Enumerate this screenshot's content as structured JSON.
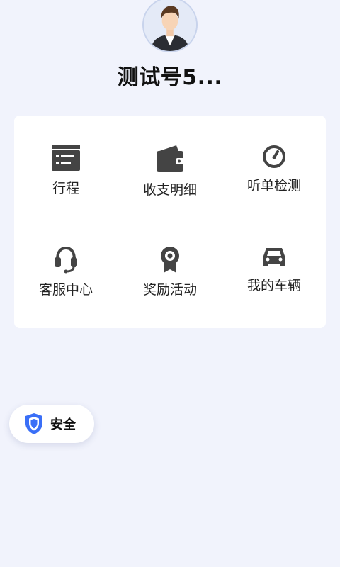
{
  "profile": {
    "name": "测试号5..."
  },
  "menu": {
    "items": [
      {
        "label": "行程",
        "icon": "itinerary-icon"
      },
      {
        "label": "收支明细",
        "icon": "wallet-icon"
      },
      {
        "label": "听单检测",
        "icon": "speedometer-icon"
      },
      {
        "label": "客服中心",
        "icon": "headset-icon"
      },
      {
        "label": "奖励活动",
        "icon": "award-badge-icon"
      },
      {
        "label": "我的车辆",
        "icon": "car-icon"
      }
    ]
  },
  "safety": {
    "label": "安全",
    "icon": "shield-icon"
  },
  "colors": {
    "background": "#f1f3fc",
    "card": "#ffffff",
    "icon": "#444444",
    "shield_accent": "#3a6ff7"
  }
}
